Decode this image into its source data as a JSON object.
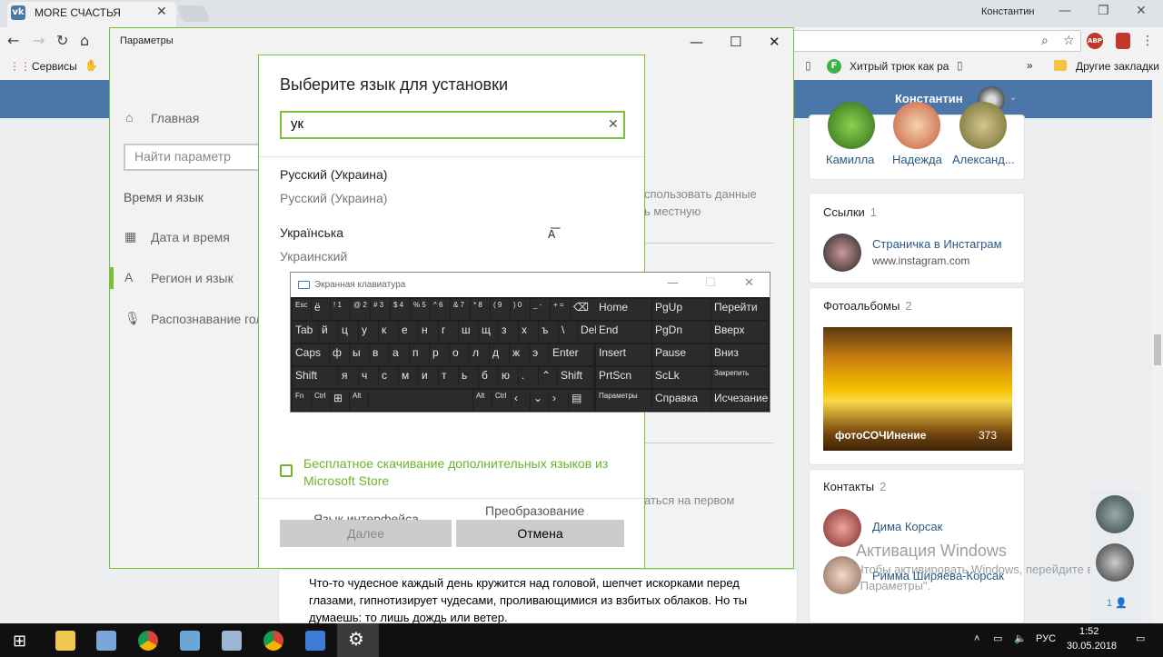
{
  "browser": {
    "tab_title": "MORE СЧАСТЬЯ",
    "tab_icon": "vk-logo-icon",
    "user": "Константин",
    "bookmarks": {
      "services": "Сервисы",
      "bookmark_1": "Хитрый трюк как ра",
      "other_bookmarks": "Другие закладки",
      "overflow": "»"
    }
  },
  "vk": {
    "user_name": "Константин",
    "friends": [
      "Камилла",
      "Надежда",
      "Александ..."
    ],
    "links_title": "Ссылки",
    "links_count": "1",
    "link_title": "Страничка в Инстаграм",
    "link_url": "www.instagram.com",
    "albums_title": "Фотоальбомы",
    "albums_count": "2",
    "album_name": "фотоСОЧИнение",
    "album_count": "373",
    "contacts_title": "Контакты",
    "contacts_count": "2",
    "contacts": [
      "Дима Корсак",
      "Римма Ширяева-Корсак"
    ],
    "post_text": "Что-то чудесное каждый день кружится над головой, шепчет искорками перед глазами, гипнотизирует чудесами, проливающимися из взбитых облаков. Но ты думаешь: то лишь дождь или ветер.",
    "side_count": "1"
  },
  "watermark": {
    "title": "Активация Windows",
    "text": "Чтобы активировать Windows, перейдите в раздел \"Параметры\"."
  },
  "settings": {
    "title": "Параметры",
    "home": "Главная",
    "search_placeholder": "Найти параметр",
    "section": "Время и язык",
    "nav_datetime": "Дата и время",
    "nav_region": "Регион и язык",
    "nav_speech": "Распознавание гол",
    "right_text_1": "спользовать данные",
    "right_text_2": "ь местную",
    "right_text_3": "аться на первом"
  },
  "dialog": {
    "title": "Выберите язык для установки",
    "search_value": "ук",
    "results": [
      {
        "name": "Русский (Украина)",
        "subtitle": "Русский (Украина)"
      },
      {
        "name": "Українська",
        "subtitle": "Украинский"
      }
    ],
    "store_link": "Бесплатное скачивание дополнительных языков из Microsoft Store",
    "partial_1": "Язык интерфейса",
    "partial_2": "Преобразование",
    "next": "Далее",
    "cancel": "Отмена"
  },
  "osk": {
    "title": "Экранная клавиатура",
    "keys": {
      "esc": "Esc",
      "yo": "ё",
      "backspace": "⌫",
      "tab": "Tab",
      "del": "Del",
      "caps": "Caps",
      "enter": "Enter",
      "shift": "Shift",
      "shift_r": "Shift",
      "fn": "Fn",
      "ctrl": "Ctrl",
      "alt": "Alt",
      "alt_r": "Alt",
      "ctrl_r": "Ctrl",
      "home": "Home",
      "pgup": "PgUp",
      "goto": "Перейти",
      "end": "End",
      "pgdn": "PgDn",
      "up": "Вверх",
      "insert": "Insert",
      "pause": "Pause",
      "down": "Вниз",
      "prtscn": "PrtScn",
      "sclk": "ScLk",
      "pin": "Закрепить",
      "options": "Параметры",
      "help": "Справка",
      "fade": "Исчезание"
    },
    "row1": [
      "1",
      "2",
      "3",
      "4",
      "5",
      "6",
      "7",
      "8",
      "9",
      "0",
      "-",
      "="
    ],
    "row1_shift": [
      "!",
      "@",
      "#",
      "$",
      "%",
      "^",
      "&",
      "*",
      "(",
      ")",
      "_",
      "+"
    ],
    "row2": [
      "й",
      "ц",
      "у",
      "к",
      "е",
      "н",
      "г",
      "ш",
      "щ",
      "з",
      "х",
      "ъ"
    ],
    "row2_extra": "\\",
    "row3": [
      "ф",
      "ы",
      "в",
      "а",
      "п",
      "р",
      "о",
      "л",
      "д",
      "ж",
      "э"
    ],
    "row4": [
      "я",
      "ч",
      "с",
      "м",
      "и",
      "т",
      "ь",
      "б",
      "ю",
      "."
    ]
  },
  "taskbar": {
    "lang": "РУС",
    "time": "1:52",
    "date": "30.05.2018"
  }
}
